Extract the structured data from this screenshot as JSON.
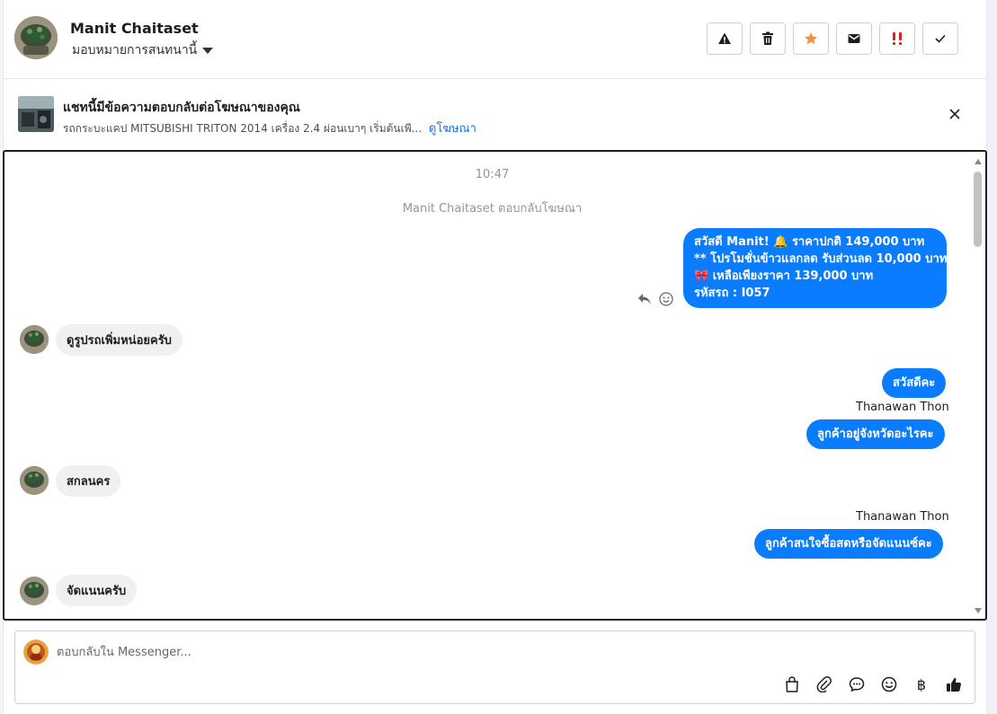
{
  "header": {
    "contact_name": "Manit Chaitaset",
    "assign_label": "มอบหมายการสนทนานี้",
    "actions": [
      {
        "name": "spam-button",
        "icon": "warning-icon"
      },
      {
        "name": "delete-button",
        "icon": "trash-icon"
      },
      {
        "name": "star-button",
        "icon": "star-icon",
        "color": "#f7923b"
      },
      {
        "name": "mark-unread-button",
        "icon": "envelope-icon"
      },
      {
        "name": "priority-button",
        "icon": "double-exclamation-icon",
        "color": "#e02020"
      },
      {
        "name": "mark-done-button",
        "icon": "check-icon"
      }
    ]
  },
  "ad_banner": {
    "title": "แชทนี้มีข้อความตอบกลับต่อโฆษณาของคุณ",
    "subtitle": "รถกระบะแคป MITSUBISHI TRITON 2014 เครื่อง 2.4 ผ่อนเบาๆ เริ่มต้นเพี...",
    "link": "ดูโฆษณา"
  },
  "chat": {
    "time": "10:47",
    "system_note": "Manit Chaitaset ตอบกลับโฆษณา",
    "messages": {
      "m1_line1": "สวัสดี Manit! 🔔 ราคาปกติ 149,000 บาท",
      "m1_line2": "** โปรโมชั่นข้าวแลกลด รับส่วนลด 10,000 บาท",
      "m1_line3": "🎀  เหลือเพียงราคา 139,000 บาท",
      "m1_line4": " รหัสรถ : I057",
      "m2": "ดูรูปรถเพิ่มหน่อยครับ",
      "m3": "สวัสดีคะ",
      "m3_sender": "Thanawan Thon",
      "m4": "ลูกค้าอยู่จังหวัดอะไรคะ",
      "m5": "สกลนคร",
      "m6_sender": "Thanawan Thon",
      "m6": "ลูกค้าสนใจซื้อสดหรือจัดแนนซ์คะ",
      "m7": "จัดแนนครับ"
    }
  },
  "composer": {
    "placeholder": "ตอบกลับใน Messenger...",
    "tools": [
      "shopping-bag-icon",
      "paperclip-icon",
      "saved-reply-icon",
      "emoji-icon",
      "baht-icon",
      "thumbs-up-icon"
    ],
    "baht_symbol": "฿"
  },
  "colors": {
    "outgoing_bubble": "#0a7cff",
    "incoming_bubble": "#f0f0f0",
    "link": "#216fdb"
  }
}
